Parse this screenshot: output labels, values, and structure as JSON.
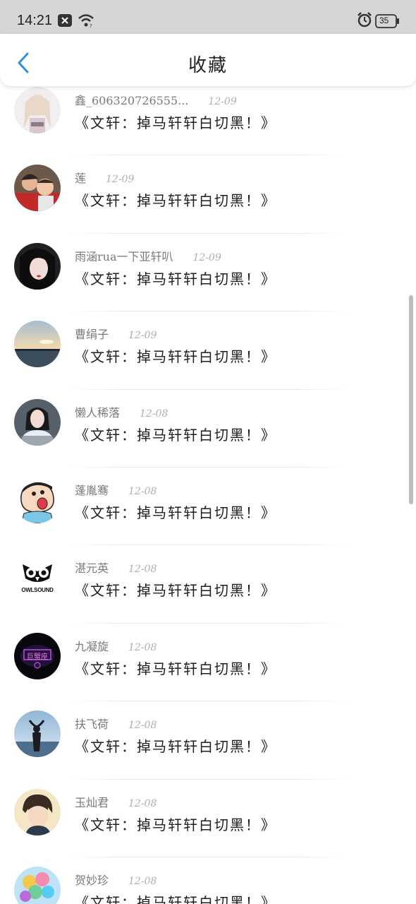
{
  "status_bar": {
    "time": "14:21",
    "battery": "35"
  },
  "header": {
    "title": "收藏"
  },
  "items": [
    {
      "name": "鑫_606320726555...",
      "date": "12-09",
      "content": "《文轩：掉马轩轩白切黑！》",
      "avatar": "girl-anime"
    },
    {
      "name": "莲",
      "date": "12-09",
      "content": "《文轩：掉马轩轩白切黑！》",
      "avatar": "family-photo"
    },
    {
      "name": "雨涵rua一下亚轩叭",
      "date": "12-09",
      "content": "《文轩：掉马轩轩白切黑！》",
      "avatar": "dark-hair-portrait"
    },
    {
      "name": "曹绢子",
      "date": "12-09",
      "content": "《文轩：掉马轩轩白切黑！》",
      "avatar": "sunset-landscape"
    },
    {
      "name": "懒人稀落",
      "date": "12-08",
      "content": "《文轩：掉马轩轩白切黑！》",
      "avatar": "girl-portrait"
    },
    {
      "name": "蓬胤骞",
      "date": "12-08",
      "content": "《文轩：掉马轩轩白切黑！》",
      "avatar": "cartoon-boy"
    },
    {
      "name": "湛元英",
      "date": "12-08",
      "content": "《文轩：掉马轩轩白切黑！》",
      "avatar": "owl-logo",
      "avatar_text": "OWLSOUND"
    },
    {
      "name": "九凝旋",
      "date": "12-08",
      "content": "《文轩：掉马轩轩白切黑！》",
      "avatar": "neon-sign",
      "avatar_text": "巨蟹座"
    },
    {
      "name": "扶飞荷",
      "date": "12-08",
      "content": "《文轩：掉马轩轩白切黑！》",
      "avatar": "beach-silhouette"
    },
    {
      "name": "玉灿君",
      "date": "12-08",
      "content": "《文轩：掉马轩轩白切黑！》",
      "avatar": "anime-boy"
    },
    {
      "name": "贺妙珍",
      "date": "12-08",
      "content": "《文轩：掉马轩轩白切黑！》",
      "avatar": "balloons"
    }
  ]
}
